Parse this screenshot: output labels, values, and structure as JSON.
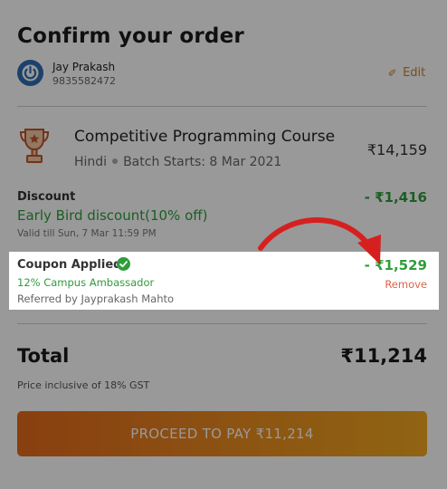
{
  "header": {
    "title": "Confirm your order"
  },
  "user": {
    "name": "Jay Prakash",
    "phone": "9835582472",
    "edit_label": "Edit"
  },
  "course": {
    "title": "Competitive Programming Course",
    "language": "Hindi",
    "batch": "Batch Starts: 8 Mar 2021",
    "price": "₹14,159"
  },
  "discount": {
    "label": "Discount",
    "name": "Early Bird discount(10% off)",
    "valid": "Valid till Sun, 7 Mar 11:59 PM",
    "amount": "- ₹1,416"
  },
  "coupon": {
    "label": "Coupon Applied",
    "name": "12% Campus Ambassador",
    "referred": "Referred by Jayprakash Mahto",
    "amount": "- ₹1,529",
    "remove_label": "Remove"
  },
  "total": {
    "label": "Total",
    "amount": "₹11,214",
    "gst_note": "Price inclusive of 18% GST"
  },
  "pay_button": {
    "label": "PROCEED TO PAY ₹11,214"
  },
  "colors": {
    "green": "#2e9d3a",
    "orange": "#e46a1c",
    "edit": "#c8842a",
    "remove": "#e0624a",
    "arrow": "#d62020"
  },
  "icons": {
    "avatar": "power-icon",
    "trophy": "trophy-icon",
    "check": "check-circle-icon",
    "edit": "pencil-icon",
    "arrow": "curved-arrow-icon"
  }
}
